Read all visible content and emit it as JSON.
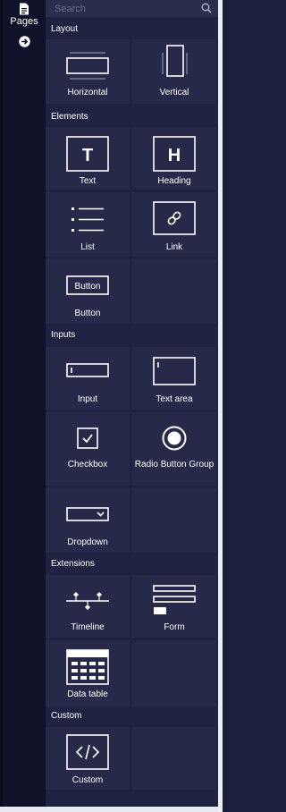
{
  "rail": {
    "pages_label": "Pages",
    "pages_icon": "document-icon",
    "collapse_icon": "arrow-circle-right-icon"
  },
  "search": {
    "placeholder": "Search",
    "value": "",
    "icon": "search-icon"
  },
  "sections": {
    "layout": {
      "title": "Layout",
      "items": [
        "Horizontal",
        "Vertical"
      ]
    },
    "elements": {
      "title": "Elements",
      "items": [
        "Text",
        "Heading",
        "List",
        "Link",
        "Button"
      ],
      "button_preview_text": "Button",
      "text_preview": "T",
      "heading_preview": "H"
    },
    "inputs": {
      "title": "Inputs",
      "items": [
        "Input",
        "Text area",
        "Checkbox",
        "Radio Button Group",
        "Dropdown"
      ]
    },
    "extensions": {
      "title": "Extensions",
      "items": [
        "Timeline",
        "Form",
        "Data table"
      ]
    },
    "custom": {
      "title": "Custom",
      "items": [
        "Custom"
      ]
    }
  },
  "colors": {
    "background": "#1f2341",
    "tile": "#262a48",
    "rail": "#101229",
    "text": "#ffffff"
  }
}
